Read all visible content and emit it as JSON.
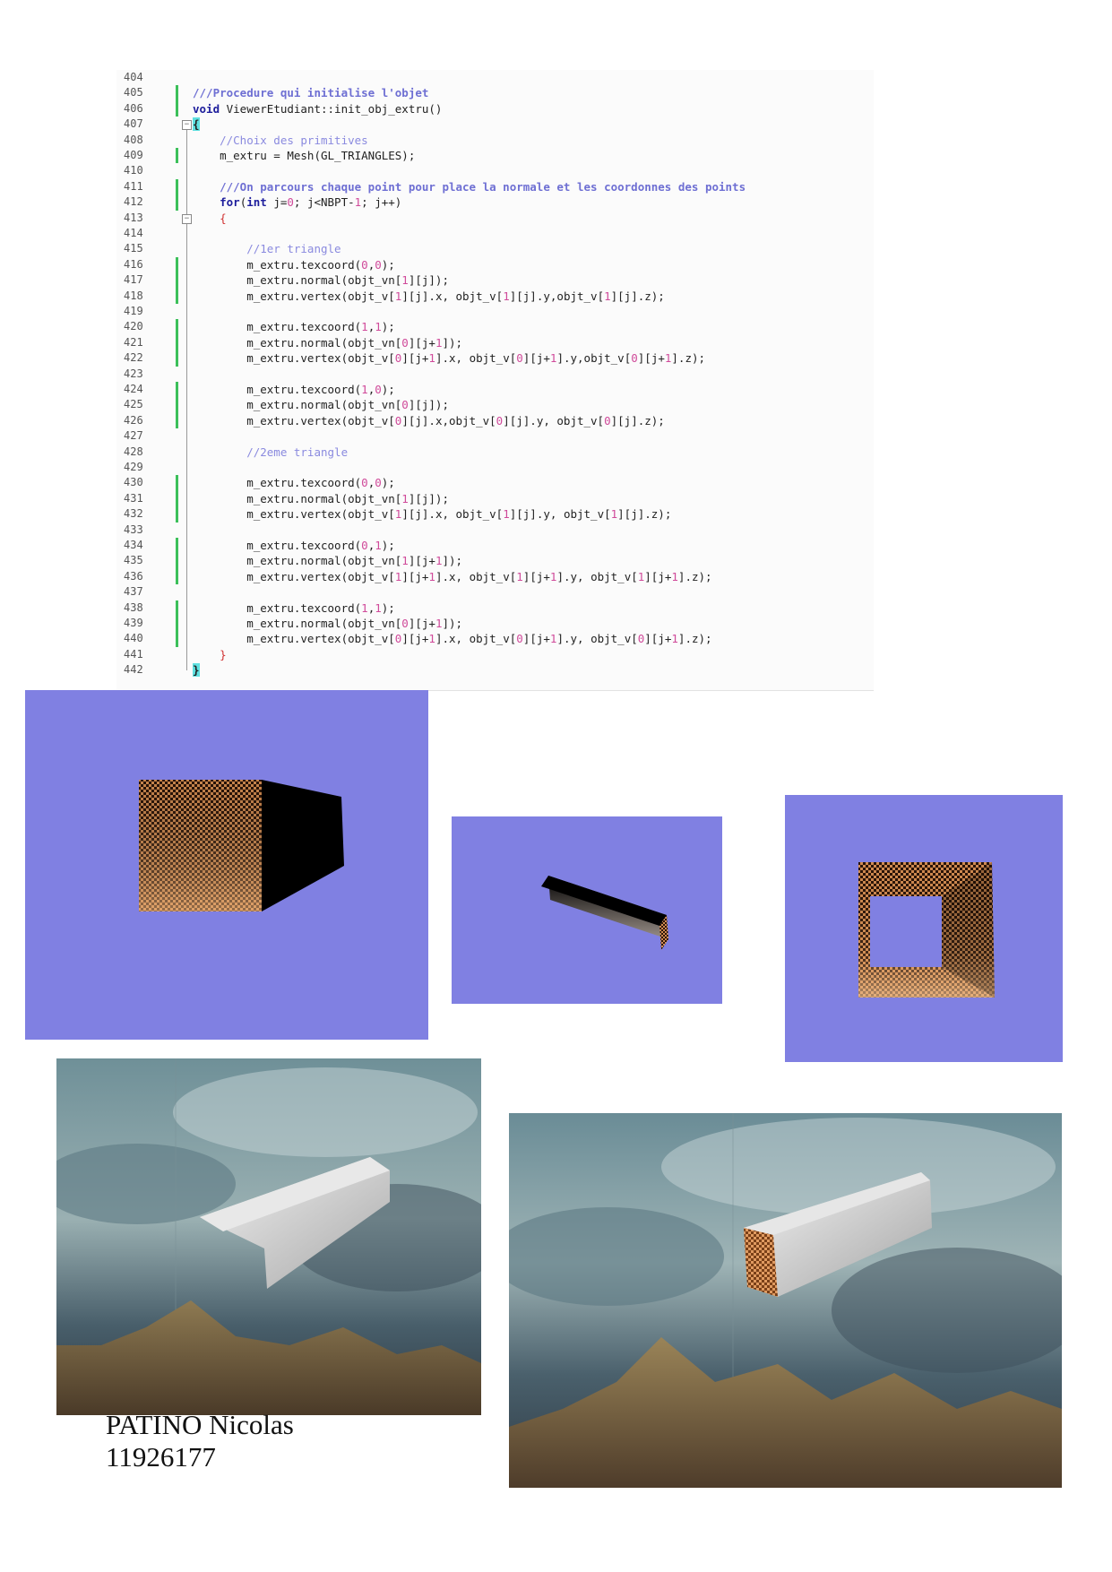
{
  "code": {
    "lines": [
      {
        "n": "404",
        "text": ""
      },
      {
        "n": "405",
        "text": "///Procedure qui initialise l'objet"
      },
      {
        "n": "406",
        "text": "void ViewerEtudiant::init_obj_extru()"
      },
      {
        "n": "407",
        "text": "{"
      },
      {
        "n": "408",
        "text": "    //Choix des primitives"
      },
      {
        "n": "409",
        "text": "    m_extru = Mesh(GL_TRIANGLES);"
      },
      {
        "n": "410",
        "text": ""
      },
      {
        "n": "411",
        "text": "    ///On parcours chaque point pour place la normale et les coordonnes des points"
      },
      {
        "n": "412",
        "text": "    for(int j=0; j<NBPT-1; j++)"
      },
      {
        "n": "413",
        "text": "    {"
      },
      {
        "n": "414",
        "text": ""
      },
      {
        "n": "415",
        "text": "        //1er triangle"
      },
      {
        "n": "416",
        "text": "        m_extru.texcoord(0,0);"
      },
      {
        "n": "417",
        "text": "        m_extru.normal(objt_vn[1][j]);"
      },
      {
        "n": "418",
        "text": "        m_extru.vertex(objt_v[1][j].x, objt_v[1][j].y,objt_v[1][j].z);"
      },
      {
        "n": "419",
        "text": ""
      },
      {
        "n": "420",
        "text": "        m_extru.texcoord(1,1);"
      },
      {
        "n": "421",
        "text": "        m_extru.normal(objt_vn[0][j+1]);"
      },
      {
        "n": "422",
        "text": "        m_extru.vertex(objt_v[0][j+1].x, objt_v[0][j+1].y,objt_v[0][j+1].z);"
      },
      {
        "n": "423",
        "text": ""
      },
      {
        "n": "424",
        "text": "        m_extru.texcoord(1,0);"
      },
      {
        "n": "425",
        "text": "        m_extru.normal(objt_vn[0][j]);"
      },
      {
        "n": "426",
        "text": "        m_extru.vertex(objt_v[0][j].x,objt_v[0][j].y, objt_v[0][j].z);"
      },
      {
        "n": "427",
        "text": ""
      },
      {
        "n": "428",
        "text": "        //2eme triangle"
      },
      {
        "n": "429",
        "text": ""
      },
      {
        "n": "430",
        "text": "        m_extru.texcoord(0,0);"
      },
      {
        "n": "431",
        "text": "        m_extru.normal(objt_vn[1][j]);"
      },
      {
        "n": "432",
        "text": "        m_extru.vertex(objt_v[1][j].x, objt_v[1][j].y, objt_v[1][j].z);"
      },
      {
        "n": "433",
        "text": ""
      },
      {
        "n": "434",
        "text": "        m_extru.texcoord(0,1);"
      },
      {
        "n": "435",
        "text": "        m_extru.normal(objt_vn[1][j+1]);"
      },
      {
        "n": "436",
        "text": "        m_extru.vertex(objt_v[1][j+1].x, objt_v[1][j+1].y, objt_v[1][j+1].z);"
      },
      {
        "n": "437",
        "text": ""
      },
      {
        "n": "438",
        "text": "        m_extru.texcoord(1,1);"
      },
      {
        "n": "439",
        "text": "        m_extru.normal(objt_vn[0][j+1]);"
      },
      {
        "n": "440",
        "text": "        m_extru.vertex(objt_v[0][j+1].x, objt_v[0][j+1].y, objt_v[0][j+1].z);"
      },
      {
        "n": "441",
        "text": "    }"
      },
      {
        "n": "442",
        "text": "}"
      }
    ]
  },
  "colors": {
    "viewport_background": "#8080e2",
    "gutter_change_bar": "#3cc05a",
    "comment": "#8a8adf",
    "keyword": "#1d1d9c",
    "number": "#d04a9a"
  },
  "figures": [
    {
      "id": "render-cube-open",
      "description_icon": "textured-extruded-cube"
    },
    {
      "id": "render-bar",
      "description_icon": "textured-extruded-bar"
    },
    {
      "id": "render-frame",
      "description_icon": "textured-square-frame"
    },
    {
      "id": "scene-1",
      "description_icon": "sky-terrain-scene"
    },
    {
      "id": "scene-2",
      "description_icon": "sky-terrain-scene"
    }
  ],
  "author": {
    "name": "PATINO Nicolas",
    "student_id": "11926177"
  }
}
